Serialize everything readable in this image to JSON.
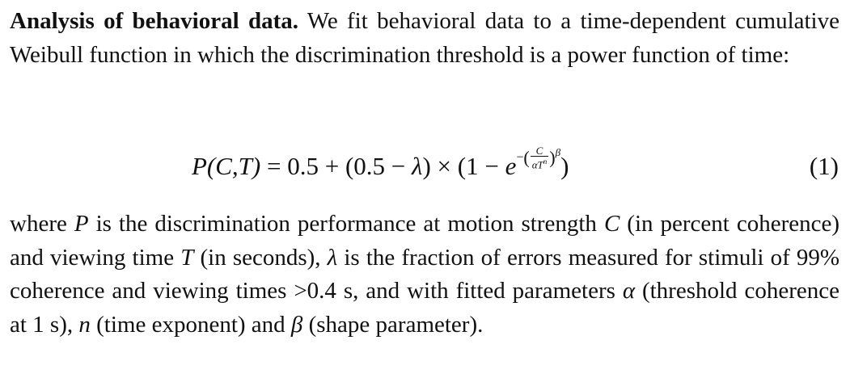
{
  "para1": {
    "lead": "Analysis of behavioral data.",
    "text": " We fit behavioral data to a time-dependent cumulative Weibull function in which the discrimination threshold is a power function of time:"
  },
  "equation": {
    "lhs": "P(C,T)",
    "equals": " = 0.5 + (0.5 − ",
    "lambda": "λ",
    "mid": ") × (1 − ",
    "e": "e",
    "exp_minus": "−",
    "frac_num": "C",
    "frac_den": "αT",
    "frac_den_exp": "n",
    "beta": "β",
    "close": ")",
    "number": "(1)"
  },
  "para2": {
    "t1": "where ",
    "v1": "P",
    "t2": " is the discrimination performance at motion strength ",
    "v2": "C",
    "t3": " (in percent coherence) and viewing time ",
    "v3": "T",
    "t4": " (in seconds), ",
    "v4": "λ",
    "t5": " is the fraction of errors measured for stimuli of 99% coherence and viewing times >0.4 s, and with fitted parameters ",
    "v5": "α",
    "t6": " (threshold coherence at 1 s), ",
    "v6": "n",
    "t7": " (time exponent) and ",
    "v7": "β",
    "t8": " (shape parameter)."
  }
}
